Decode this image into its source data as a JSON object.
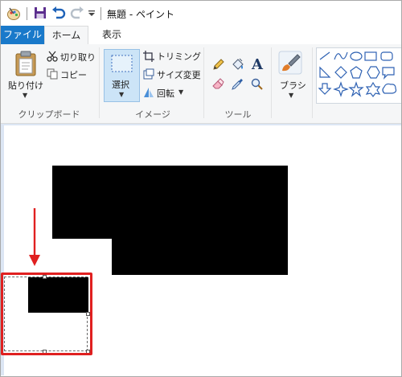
{
  "window": {
    "title": "無題 - ペイント"
  },
  "tabs": {
    "file": "ファイル",
    "home": "ホーム",
    "view": "表示"
  },
  "clipboard": {
    "paste": "貼り付け",
    "cut": "切り取り",
    "copy": "コピー",
    "group_label": "クリップボード"
  },
  "image": {
    "select": "選択",
    "crop": "トリミング",
    "resize": "サイズ変更",
    "rotate": "回転",
    "group_label": "イメージ"
  },
  "tools": {
    "group_label": "ツール"
  },
  "brushes": {
    "label": "ブラシ"
  },
  "colors": {
    "accent": "#1979ca",
    "annotation": "#e02020",
    "selection_bg": "#cce4f7"
  }
}
